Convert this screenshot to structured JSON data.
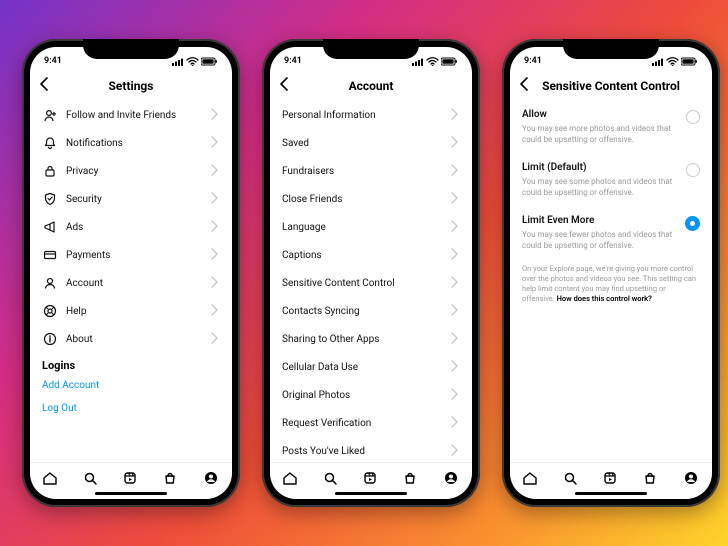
{
  "status": {
    "time": "9:41"
  },
  "phone1": {
    "title": "Settings",
    "items": [
      {
        "icon": "person-plus",
        "label": "Follow and Invite Friends"
      },
      {
        "icon": "bell",
        "label": "Notifications"
      },
      {
        "icon": "lock",
        "label": "Privacy"
      },
      {
        "icon": "shield",
        "label": "Security"
      },
      {
        "icon": "megaphone",
        "label": "Ads"
      },
      {
        "icon": "card",
        "label": "Payments"
      },
      {
        "icon": "user",
        "label": "Account"
      },
      {
        "icon": "life",
        "label": "Help"
      },
      {
        "icon": "info",
        "label": "About"
      }
    ],
    "logins_header": "Logins",
    "add_account": "Add Account",
    "log_out": "Log Out"
  },
  "phone2": {
    "title": "Account",
    "items": [
      "Personal Information",
      "Saved",
      "Fundraisers",
      "Close Friends",
      "Language",
      "Captions",
      "Sensitive Content Control",
      "Contacts Syncing",
      "Sharing to Other Apps",
      "Cellular Data Use",
      "Original Photos",
      "Request Verification",
      "Posts You've Liked"
    ]
  },
  "phone3": {
    "title": "Sensitive Content Control",
    "options": [
      {
        "title": "Allow",
        "desc": "You may see more photos and videos that could be upsetting or offensive.",
        "selected": false
      },
      {
        "title": "Limit (Default)",
        "desc": "You may see some photos and videos that could be upsetting or offensive.",
        "selected": false
      },
      {
        "title": "Limit Even More",
        "desc": "You may see fewer photos and videos that could be upsetting or offensive.",
        "selected": true
      }
    ],
    "footer_text": "On your Explore page, we're giving you more control over the photos and videos you see. This setting can help limit content you may find upsetting or offensive. ",
    "footer_link": "How does this control work?"
  }
}
